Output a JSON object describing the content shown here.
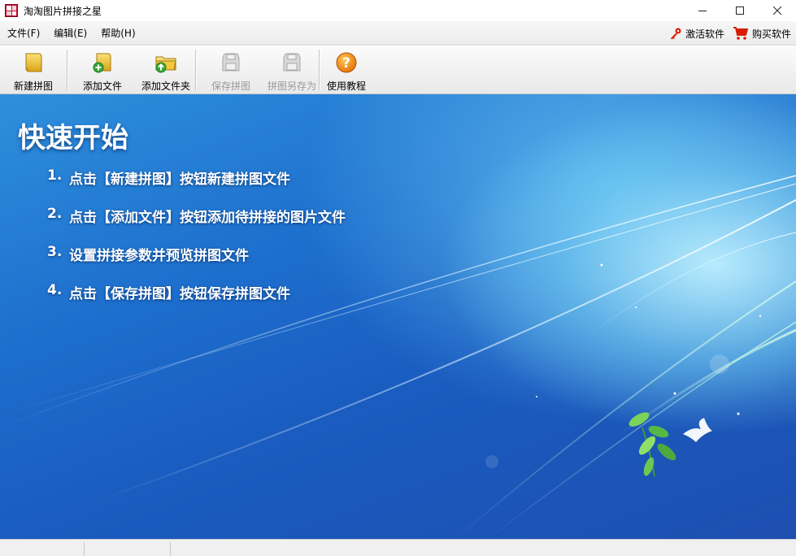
{
  "window": {
    "title": "淘淘图片拼接之星",
    "controls": [
      "minimize",
      "maximize",
      "close"
    ]
  },
  "menu": {
    "items": [
      "文件(F)",
      "编辑(E)",
      "帮助(H)"
    ],
    "right": {
      "activate_label": "激活软件",
      "activate_icon": "key-icon",
      "buy_label": "购买软件",
      "buy_icon": "cart-icon"
    }
  },
  "toolbar": {
    "buttons": [
      {
        "label": "新建拼图",
        "icon": "new-puzzle-icon",
        "enabled": true
      },
      {
        "label": "添加文件",
        "icon": "add-file-icon",
        "enabled": true
      },
      {
        "label": "添加文件夹",
        "icon": "add-folder-icon",
        "enabled": true
      },
      {
        "label": "保存拼图",
        "icon": "save-puzzle-icon",
        "enabled": false
      },
      {
        "label": "拼图另存为",
        "icon": "save-as-icon",
        "enabled": false
      },
      {
        "label": "使用教程",
        "icon": "help-icon",
        "enabled": true
      }
    ]
  },
  "quick_start": {
    "title": "快速开始",
    "steps": [
      {
        "num": "1.",
        "text": "点击【新建拼图】按钮新建拼图文件"
      },
      {
        "num": "2.",
        "text": "点击【添加文件】按钮添加待拼接的图片文件"
      },
      {
        "num": "3.",
        "text": "设置拼接参数并预览拼图文件"
      },
      {
        "num": "4.",
        "text": "点击【保存拼图】按钮保存拼图文件"
      }
    ]
  },
  "colors": {
    "accent": "#1d6fcd",
    "key": "#d81e06",
    "cart": "#d81e06",
    "help": "#f08a00"
  }
}
